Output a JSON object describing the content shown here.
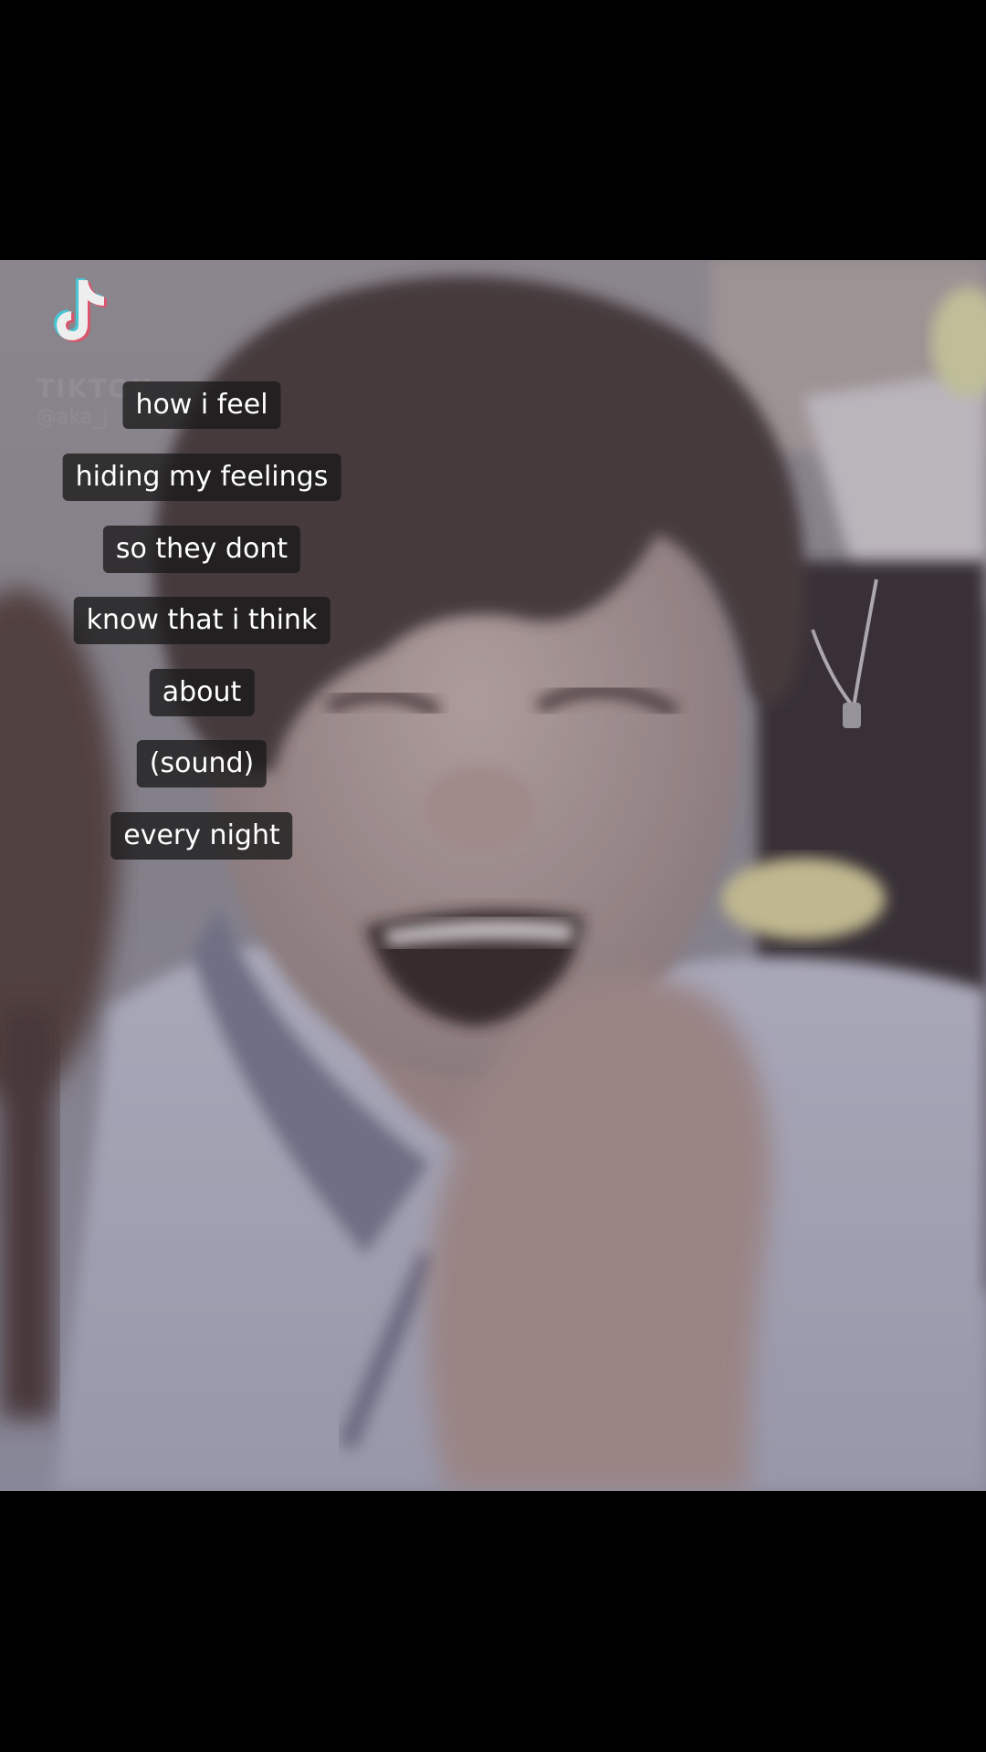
{
  "watermark": {
    "icon": "tiktok-logo-icon",
    "brand": "TIKTOK",
    "handle": "@aka_j"
  },
  "captions": [
    "how i feel",
    "hiding my feelings",
    "so they dont",
    "know that i think",
    "about",
    "(sound)",
    "every night"
  ],
  "colors": {
    "letterbox": "#000000",
    "caption_bg": "#191919",
    "caption_text": "#ffffff"
  }
}
